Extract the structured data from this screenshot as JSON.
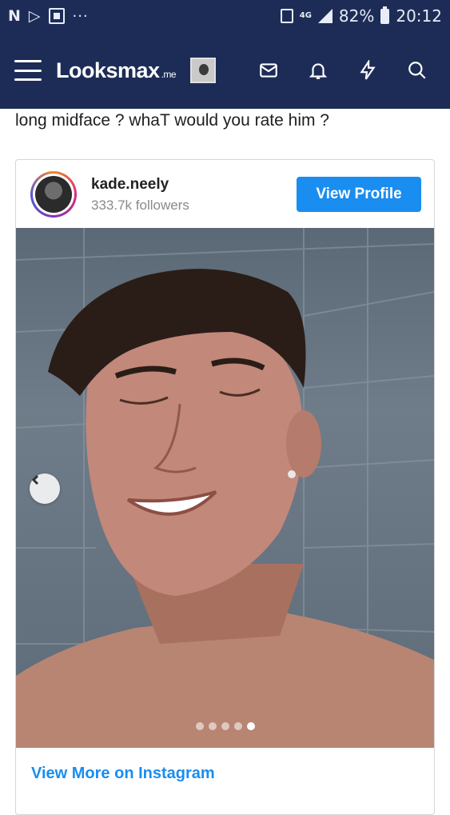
{
  "status_bar": {
    "left_icons": [
      "N",
      "play-store-icon",
      "flipboard-icon",
      "overflow-dots-icon"
    ],
    "network": "4G",
    "battery": "82%",
    "time": "20:12"
  },
  "app_bar": {
    "logo_main": "Looksmax",
    "logo_suffix": ".me",
    "icons": [
      "menu-icon",
      "avatar",
      "inbox-icon",
      "bell-icon",
      "bolt-icon",
      "search-icon"
    ]
  },
  "post": {
    "text": "long midface ? whaT would you rate him ?"
  },
  "embed": {
    "username": "kade.neely",
    "followers": "333.7k followers",
    "view_profile_label": "View Profile",
    "view_more_label": "View More on Instagram",
    "carousel": {
      "count": 5,
      "active_index": 4
    },
    "colors": {
      "accent": "#1a8df0",
      "header_bg": "#1d2c57"
    }
  }
}
